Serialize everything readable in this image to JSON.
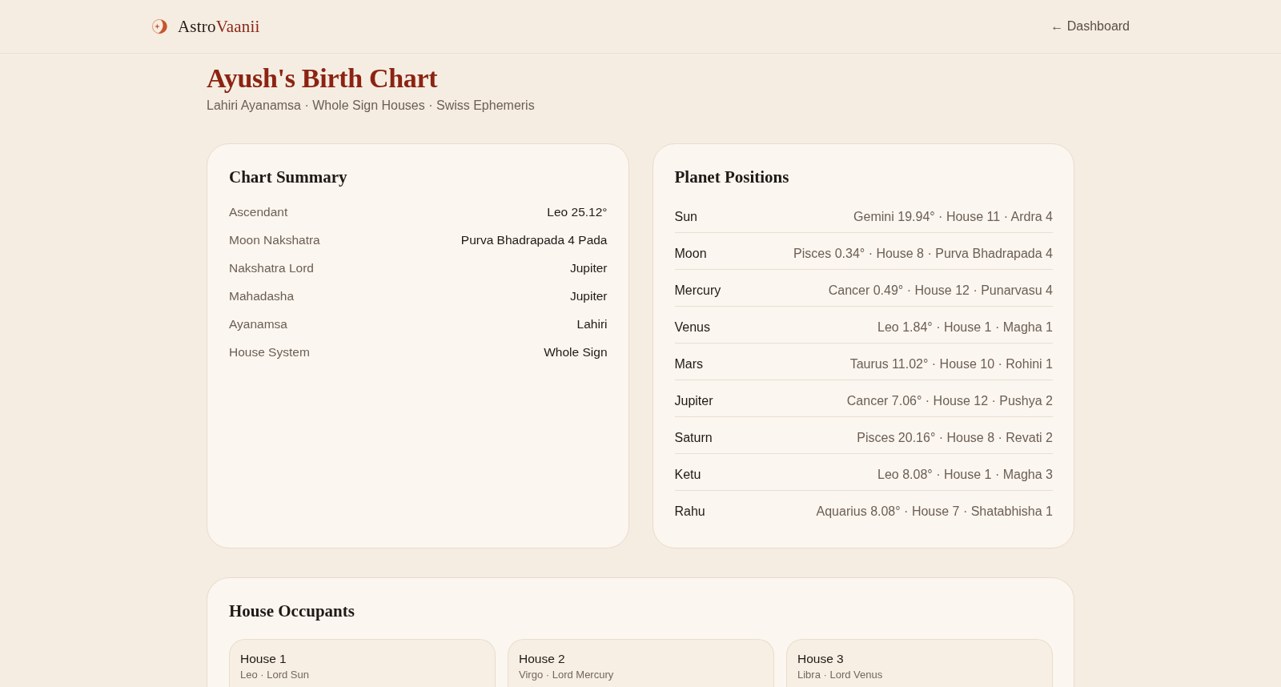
{
  "header": {
    "brand_prefix": "Astro",
    "brand_suffix": "Vaanii",
    "back_link": "← Dashboard"
  },
  "page": {
    "title": "Ayush's Birth Chart",
    "subtitle": "Lahiri Ayanamsa · Whole Sign Houses · Swiss Ephemeris"
  },
  "chart_summary": {
    "title": "Chart Summary",
    "rows": [
      {
        "label": "Ascendant",
        "value": "Leo 25.12°"
      },
      {
        "label": "Moon Nakshatra",
        "value": "Purva Bhadrapada 4 Pada"
      },
      {
        "label": "Nakshatra Lord",
        "value": "Jupiter"
      },
      {
        "label": "Mahadasha",
        "value": "Jupiter"
      },
      {
        "label": "Ayanamsa",
        "value": "Lahiri"
      },
      {
        "label": "House System",
        "value": "Whole Sign"
      }
    ]
  },
  "planet_positions": {
    "title": "Planet Positions",
    "rows": [
      {
        "planet": "Sun",
        "details": "Gemini 19.94° · House 11 · Ardra 4"
      },
      {
        "planet": "Moon",
        "details": "Pisces 0.34° · House 8 · Purva Bhadrapada 4"
      },
      {
        "planet": "Mercury",
        "details": "Cancer 0.49° · House 12 · Punarvasu 4"
      },
      {
        "planet": "Venus",
        "details": "Leo 1.84° · House 1 · Magha 1"
      },
      {
        "planet": "Mars",
        "details": "Taurus 11.02° · House 10 · Rohini 1"
      },
      {
        "planet": "Jupiter",
        "details": "Cancer 7.06° · House 12 · Pushya 2"
      },
      {
        "planet": "Saturn",
        "details": "Pisces 20.16° · House 8 · Revati 2"
      },
      {
        "planet": "Ketu",
        "details": "Leo 8.08° · House 1 · Magha 3"
      },
      {
        "planet": "Rahu",
        "details": "Aquarius 8.08° · House 7 · Shatabhisha 1"
      }
    ]
  },
  "house_occupants": {
    "title": "House Occupants",
    "houses": [
      {
        "name": "House 1",
        "details": "Leo · Lord Sun"
      },
      {
        "name": "House 2",
        "details": "Virgo · Lord Mercury"
      },
      {
        "name": "House 3",
        "details": "Libra · Lord Venus"
      }
    ]
  }
}
